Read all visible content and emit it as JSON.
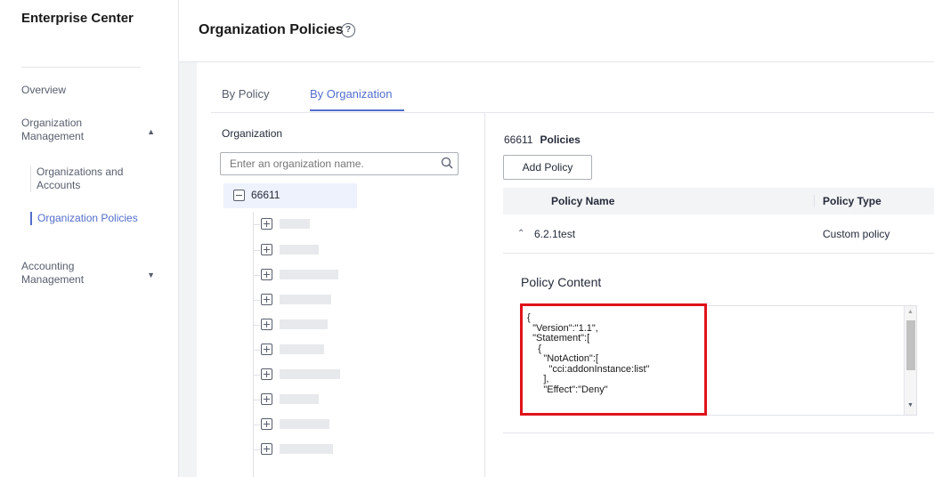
{
  "sidebar": {
    "brand": "Enterprise Center",
    "overview": "Overview",
    "org_management": "Organization Management",
    "sub_items": [
      "Organizations and Accounts",
      "Organization Policies"
    ],
    "accounting_management": "Accounting Management"
  },
  "header": {
    "title": "Organization Policies",
    "help_icon": "?"
  },
  "tabs": [
    "By Policy",
    "By Organization"
  ],
  "tree": {
    "label": "Organization",
    "search_placeholder": "Enter an organization name.",
    "root": "66611"
  },
  "policies": {
    "org_id": "66611",
    "heading": "Policies",
    "add_button": "Add Policy",
    "columns": [
      "Policy Name",
      "Policy Type"
    ],
    "rows": [
      {
        "name": "6.2.1test",
        "type": "Custom policy"
      }
    ],
    "content_title": "Policy Content",
    "content": "{\n  \"Version\":\"1.1\",\n  \"Statement\":[\n    {\n      \"NotAction\":[\n        \"cci:addonInstance:list\"\n      ],\n      \"Effect\":\"Deny\""
  },
  "icons": {
    "search": "search-icon",
    "expand_up": "chevron-up-icon",
    "collapse_down": "chevron-down-icon"
  },
  "colors": {
    "accent": "#526ecc",
    "highlight": "#e0121b"
  }
}
